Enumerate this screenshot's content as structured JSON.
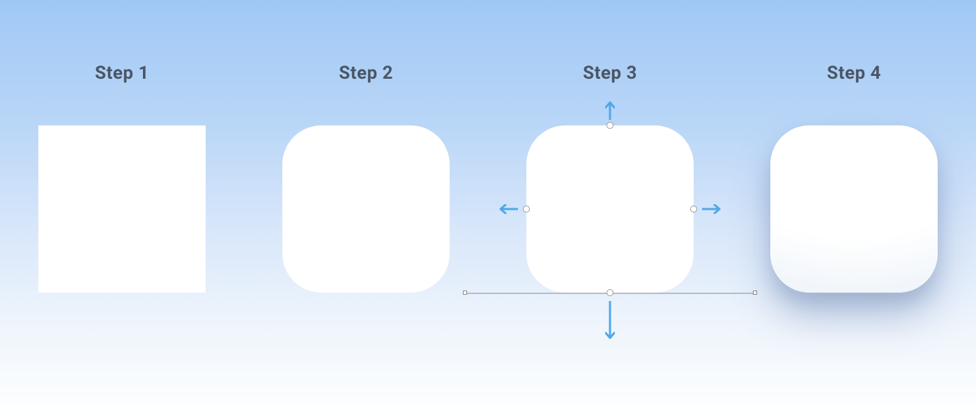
{
  "steps": [
    {
      "label": "Step 1",
      "shape": "square"
    },
    {
      "label": "Step 2",
      "shape": "rounded"
    },
    {
      "label": "Step 3",
      "shape": "rounded_editing"
    },
    {
      "label": "Step 4",
      "shape": "rounded_final"
    }
  ],
  "colors": {
    "arrow": "#4ea8e8",
    "handle_border": "#9a9a9a",
    "label": "#4a5666"
  }
}
